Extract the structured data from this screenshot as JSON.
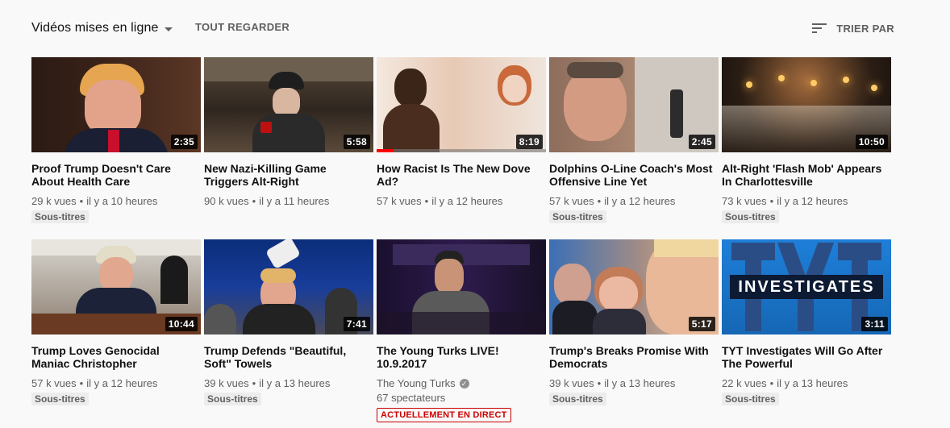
{
  "header": {
    "title": "Vidéos mises en ligne",
    "play_all": "TOUT REGARDER",
    "sort_label": "TRIER PAR"
  },
  "videos": [
    {
      "title": "Proof Trump Doesn't Care About Health Care",
      "views": "29 k vues",
      "age": "il y a 10 heures",
      "badge": "Sous-titres",
      "duration": "2:35"
    },
    {
      "title": "New Nazi-Killing Game Triggers Alt-Right",
      "views": "90 k vues",
      "age": "il y a 11 heures",
      "duration": "5:58"
    },
    {
      "title": "How Racist Is The New Dove Ad?",
      "views": "57 k vues",
      "age": "il y a 12 heures",
      "duration": "8:19",
      "watched_fraction": 0.1
    },
    {
      "title": "Dolphins O-Line Coach's Most Offensive Line Yet",
      "views": "57 k vues",
      "age": "il y a 12 heures",
      "badge": "Sous-titres",
      "duration": "2:45"
    },
    {
      "title": "Alt-Right 'Flash Mob' Appears In Charlottesville",
      "views": "73 k vues",
      "age": "il y a 12 heures",
      "badge": "Sous-titres",
      "duration": "10:50"
    },
    {
      "title": "Trump Loves Genocidal Maniac Christopher",
      "views": "57 k vues",
      "age": "il y a 12 heures",
      "badge": "Sous-titres",
      "duration": "10:44"
    },
    {
      "title": "Trump Defends \"Beautiful, Soft\" Towels",
      "views": "39 k vues",
      "age": "il y a 13 heures",
      "badge": "Sous-titres",
      "duration": "7:41"
    },
    {
      "title": "The Young Turks LIVE! 10.9.2017",
      "channel": "The Young Turks",
      "viewers": "67 spectateurs",
      "live_badge": "ACTUELLEMENT EN DIRECT"
    },
    {
      "title": "Trump's Breaks Promise With Democrats",
      "views": "39 k vues",
      "age": "il y a 13 heures",
      "badge": "Sous-titres",
      "duration": "5:17"
    },
    {
      "title": "TYT Investigates Will Go After The Powerful",
      "views": "22 k vues",
      "age": "il y a 13 heures",
      "badge": "Sous-titres",
      "duration": "3:11"
    }
  ],
  "thumbnail_text": {
    "tyt_investigates": "INVESTIGATES"
  },
  "colors": {
    "live_red": "#cc0000",
    "progress_red": "#ff0000",
    "text_secondary": "#606060"
  }
}
